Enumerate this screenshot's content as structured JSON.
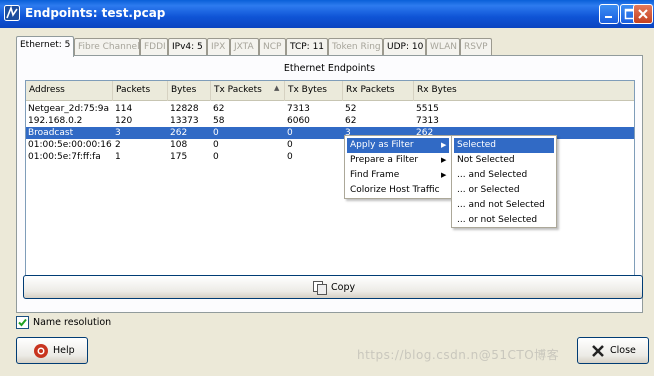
{
  "window": {
    "title": "Endpoints: test.pcap"
  },
  "tabs": [
    {
      "label": "Ethernet: 5",
      "state": "active"
    },
    {
      "label": "Fibre Channel",
      "state": "disabled"
    },
    {
      "label": "FDDI",
      "state": "disabled"
    },
    {
      "label": "IPv4: 5",
      "state": "enabled"
    },
    {
      "label": "IPX",
      "state": "disabled"
    },
    {
      "label": "JXTA",
      "state": "disabled"
    },
    {
      "label": "NCP",
      "state": "disabled"
    },
    {
      "label": "TCP: 11",
      "state": "enabled"
    },
    {
      "label": "Token Ring",
      "state": "disabled"
    },
    {
      "label": "UDP: 10",
      "state": "enabled"
    },
    {
      "label": "WLAN",
      "state": "disabled"
    },
    {
      "label": "RSVP",
      "state": "disabled"
    }
  ],
  "panel": {
    "title": "Ethernet Endpoints"
  },
  "table": {
    "columns": [
      "Address",
      "Packets",
      "Bytes",
      "Tx Packets",
      "Tx Bytes",
      "Rx Packets",
      "Rx Bytes"
    ],
    "sorted_column": "Tx Packets",
    "rows": [
      {
        "cells": [
          "Netgear_2d:75:9a",
          "114",
          "12828",
          "62",
          "7313",
          "52",
          "5515"
        ]
      },
      {
        "cells": [
          "192.168.0.2",
          "120",
          "13373",
          "58",
          "6060",
          "62",
          "7313"
        ]
      },
      {
        "cells": [
          "Broadcast",
          "3",
          "262",
          "0",
          "0",
          "3",
          "262"
        ],
        "selected": true
      },
      {
        "cells": [
          "01:00:5e:00:00:16",
          "2",
          "108",
          "0",
          "0",
          "",
          ""
        ]
      },
      {
        "cells": [
          "01:00:5e:7f:ff:fa",
          "1",
          "175",
          "0",
          "0",
          "",
          ""
        ]
      }
    ]
  },
  "context_menu": {
    "items": [
      {
        "label": "Apply as Filter",
        "submenu": true,
        "highlighted": true
      },
      {
        "label": "Prepare a Filter",
        "submenu": true
      },
      {
        "label": "Find Frame",
        "submenu": true
      },
      {
        "label": "Colorize Host Traffic",
        "submenu": false
      }
    ]
  },
  "submenu": {
    "items": [
      {
        "label": "Selected",
        "highlighted": true
      },
      {
        "label": "Not Selected"
      },
      {
        "label": "... and Selected"
      },
      {
        "label": "... or Selected"
      },
      {
        "label": "... and not Selected"
      },
      {
        "label": "... or not Selected"
      }
    ]
  },
  "buttons": {
    "copy": "Copy",
    "help": "Help",
    "close": "Close"
  },
  "options": {
    "name_resolution_label": "Name resolution",
    "name_resolution_checked": true
  },
  "watermark": "https://blog.csdn.n@51CTO博客",
  "colors": {
    "titlebar": "#0a5fd8",
    "selection": "#316ac5",
    "accent_check": "#21a121"
  }
}
